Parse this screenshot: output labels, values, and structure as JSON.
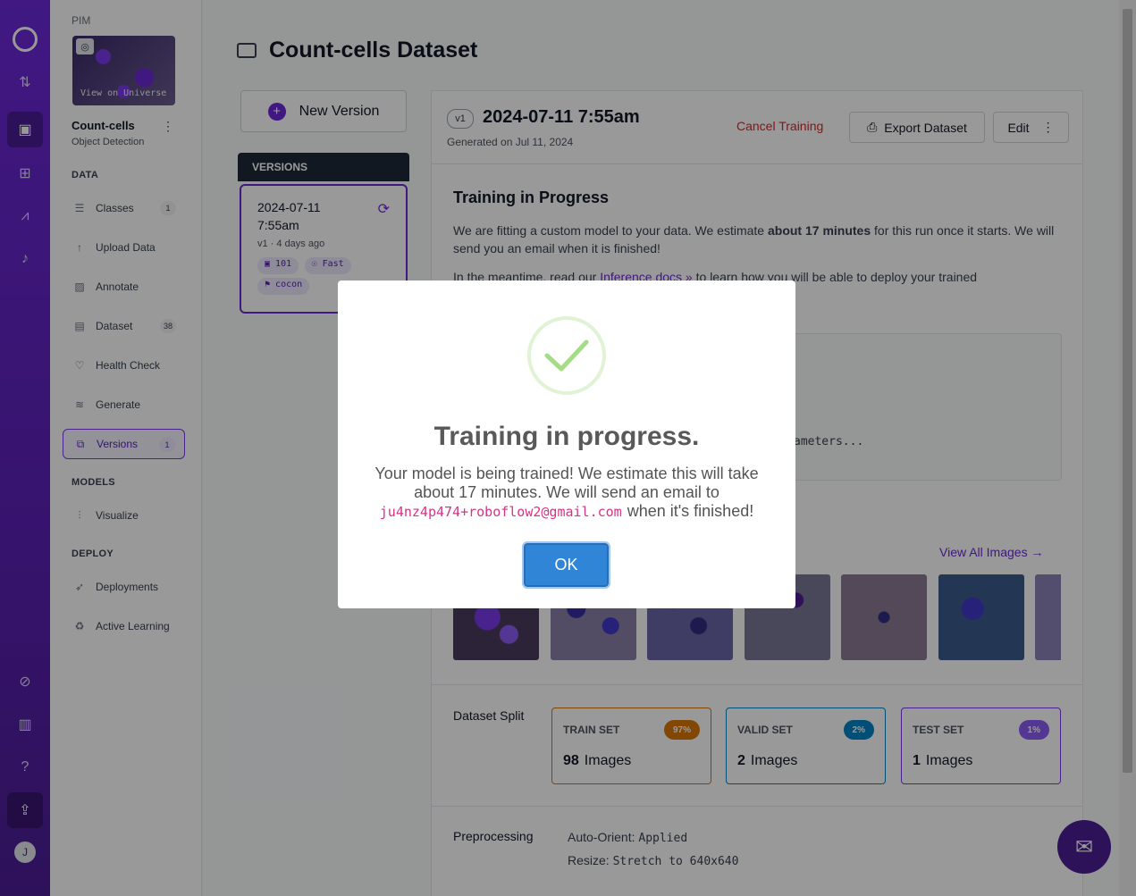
{
  "sidebar": {
    "workspace": "PIM",
    "thumb_text": "View on Universe",
    "project_name": "Count-cells",
    "project_type": "Object Detection",
    "sections": {
      "data": "DATA",
      "models": "MODELS",
      "deploy": "DEPLOY"
    },
    "items": {
      "classes": {
        "label": "Classes",
        "badge": "1"
      },
      "upload": {
        "label": "Upload Data"
      },
      "annotate": {
        "label": "Annotate"
      },
      "dataset": {
        "label": "Dataset",
        "badge": "38"
      },
      "health": {
        "label": "Health Check"
      },
      "generate": {
        "label": "Generate"
      },
      "versions": {
        "label": "Versions",
        "badge": "1"
      },
      "visualize": {
        "label": "Visualize"
      },
      "deployments": {
        "label": "Deployments"
      },
      "active_learning": {
        "label": "Active Learning"
      }
    },
    "avatar_initial": "J"
  },
  "main": {
    "title": "Count-cells Dataset",
    "new_version_label": "New Version",
    "versions_header": "VERSIONS",
    "version_card": {
      "date": "2024-07-11 7:55am",
      "sub": "v1 · 4 days ago",
      "tags": [
        "101",
        "Fast",
        "cocon"
      ]
    },
    "panel": {
      "version_badge": "v1",
      "date": "2024-07-11 7:55am",
      "generated": "Generated on Jul 11, 2024",
      "cancel_label": "Cancel Training",
      "export_label": "Export Dataset",
      "edit_label": "Edit",
      "training_title": "Training in Progress",
      "training_text_a": "We are fitting a custom model to your data. We estimate ",
      "training_text_bold": "about 17 minutes",
      "training_text_b": " for this run once it starts. We will send you an email when it is finished!",
      "meantime_a": "In the meantime, read our ",
      "meantime_link": "Inference docs",
      "meantime_b": " to learn how you will be able to deploy your trained",
      "log_text": "ameters...",
      "view_all": "View All Images",
      "split_label": "Dataset Split",
      "splits": [
        {
          "title": "TRAIN SET",
          "pct": "97%",
          "count": "98",
          "unit": "Images",
          "color": "#d97706"
        },
        {
          "title": "VALID SET",
          "pct": "2%",
          "count": "2",
          "unit": "Images",
          "color": "#0284c7"
        },
        {
          "title": "TEST SET",
          "pct": "1%",
          "count": "1",
          "unit": "Images",
          "color": "#7c3aed"
        }
      ],
      "preprocessing_label": "Preprocessing",
      "pre_orient_key": "Auto-Orient:",
      "pre_orient_val": "Applied",
      "pre_resize_key": "Resize:",
      "pre_resize_val": "Stretch to 640x640"
    }
  },
  "modal": {
    "title": "Training in progress.",
    "text_a": "Your model is being trained! We estimate this will take about 17 minutes. We will send an email to",
    "email": "ju4nz4p474+roboflow2@gmail.com",
    "text_b": "when it's finished!",
    "ok_label": "OK"
  },
  "colors": {
    "brand": "#6d28d9",
    "danger": "#dc2626",
    "ok_button": "#3085d6",
    "success": "#a5dc86"
  }
}
